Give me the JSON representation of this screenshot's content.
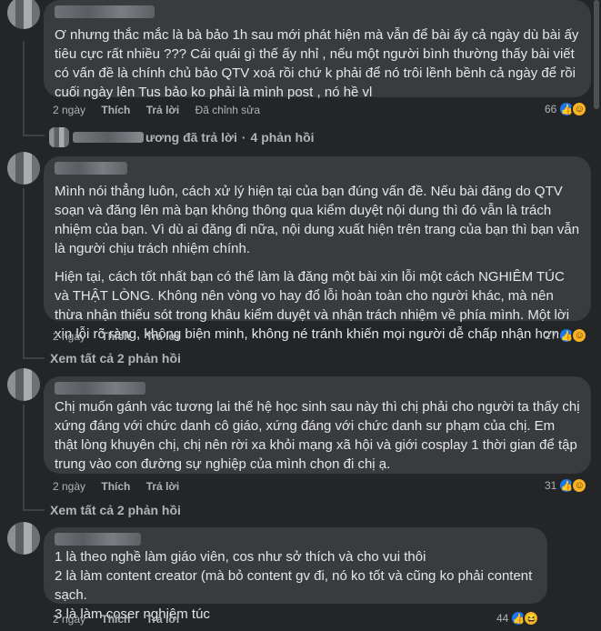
{
  "comments": [
    {
      "text": "Ơ nhưng thắc mắc là bà bảo 1h sau mới phát hiện mà vẫn để bài ấy cả ngày dù bài ấy tiêu cực rất nhiều ??? Cái quái gì thế ấy nhỉ , nếu một người bình thường thấy bài viết có vấn đề là chính chủ bảo QTV xoá rồi chứ k phải để nó trôi lềnh bềnh cả ngày để rồi cuối ngày lên Tus bảo ko phải là mình post , nó hề vl",
      "time": "2 ngày",
      "like": "Thích",
      "reply": "Trả lời",
      "edited": "Đã chỉnh sửa",
      "reactions": "66"
    },
    {
      "paragraphs": [
        "Mình nói thẳng luôn, cách xử lý hiện tại của bạn đúng vấn đề. Nếu bài đăng do QTV soạn và đăng lên mà bạn không thông qua kiểm duyệt nội dung thì đó vẫn là trách nhiệm của bạn. Vì dù ai đăng đi nữa, nội dung xuất hiện trên trang của bạn thì bạn vẫn là người chịu trách nhiệm chính.",
        "Hiện tại, cách tốt nhất bạn có thể làm là đăng một bài xin lỗi một cách NGHIÊM TÚC và THẬT LÒNG. Không nên vòng vo hay đổ lỗi hoàn toàn cho người khác, mà nên thừa nhận thiếu sót trong khâu kiểm duyệt và nhận trách nhiệm về phía mình. Một lời xin lỗi rõ ràng, không biện minh, không né tránh khiến mọi người dễ chấp nhận hơn"
      ],
      "time": "2 ngày",
      "like": "Thích",
      "reply": "Trả lời",
      "reactions": "27"
    },
    {
      "text": "Chị muốn gánh vác tương lai thế hệ học sinh sau này thì chị phải cho người ta thấy chị xứng đáng với chức danh cô giáo, xứng đáng với chức danh sư phạm của chị. Em thật lòng khuyên chị, chị nên rời xa khỏi mạng xã hội và giới cosplay 1 thời gian để tập trung vào con đường sự nghiệp của mình chọn đi chị ạ.",
      "time": "2 ngày",
      "like": "Thích",
      "reply": "Trả lời",
      "reactions": "31"
    },
    {
      "lines": [
        "1 là theo nghề làm giáo viên, cos như sở thích và cho vui thôi",
        "2 là làm content creator (mà bỏ content gv đi, nó ko tốt và cũng ko phải content sạch.",
        "3 là làm coser nghiêm túc"
      ],
      "time": "2 ngày",
      "like": "Thích",
      "reply": "Trả lời",
      "reactions": "44"
    }
  ],
  "reply_summary": {
    "name_suffix": "ương đã trả lời",
    "separator": "·",
    "count": "4 phản hồi"
  },
  "view_more": [
    "Xem tất cả 2 phản hồi",
    "Xem tất cả 2 phản hồi"
  ],
  "icons": {
    "like": "like-reaction-icon",
    "care": "care-reaction-icon",
    "laugh": "haha-reaction-icon",
    "reply_arrow": "reply-arrow-icon"
  },
  "colors": {
    "background": "#242526",
    "bubble": "#3a3b3c",
    "text": "#e4e6eb",
    "meta": "#b0b3b8",
    "like_blue": "#1877f2"
  }
}
